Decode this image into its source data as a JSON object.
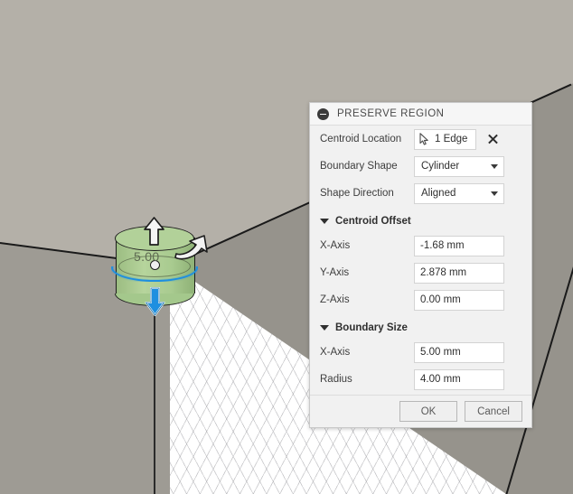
{
  "viewport": {
    "dimension_label": "5.00",
    "icons": {
      "move_up_arrow": "arrow-up-icon",
      "move_down_arrow": "arrow-down-icon",
      "rotate_arrow": "rotate-arrow-icon"
    },
    "colors": {
      "preview_body": "#b2d199",
      "selected_edge": "#1e8fe0",
      "face_top": "#b4b0a8",
      "face_left": "#9e9b94",
      "face_right": "#96938c"
    }
  },
  "panel": {
    "title": "PRESERVE REGION",
    "collapse_icon": "minus-circle-icon",
    "rows": [
      {
        "label": "Centroid Location",
        "type": "selection",
        "value": "1 Edge",
        "icon": "cursor-select-icon",
        "clear_icon": "close-icon"
      },
      {
        "label": "Boundary Shape",
        "type": "dropdown",
        "value": "Cylinder"
      },
      {
        "label": "Shape Direction",
        "type": "dropdown",
        "value": "Aligned"
      }
    ],
    "sections": [
      {
        "title": "Centroid Offset",
        "expanded": true,
        "fields": [
          {
            "label": "X-Axis",
            "value": "-1.68 mm"
          },
          {
            "label": "Y-Axis",
            "value": "2.878 mm"
          },
          {
            "label": "Z-Axis",
            "value": "0.00 mm"
          }
        ]
      },
      {
        "title": "Boundary Size",
        "expanded": true,
        "fields": [
          {
            "label": "X-Axis",
            "value": "5.00 mm"
          },
          {
            "label": "Radius",
            "value": "4.00 mm"
          }
        ]
      }
    ],
    "footer": {
      "ok_label": "OK",
      "cancel_label": "Cancel"
    }
  }
}
